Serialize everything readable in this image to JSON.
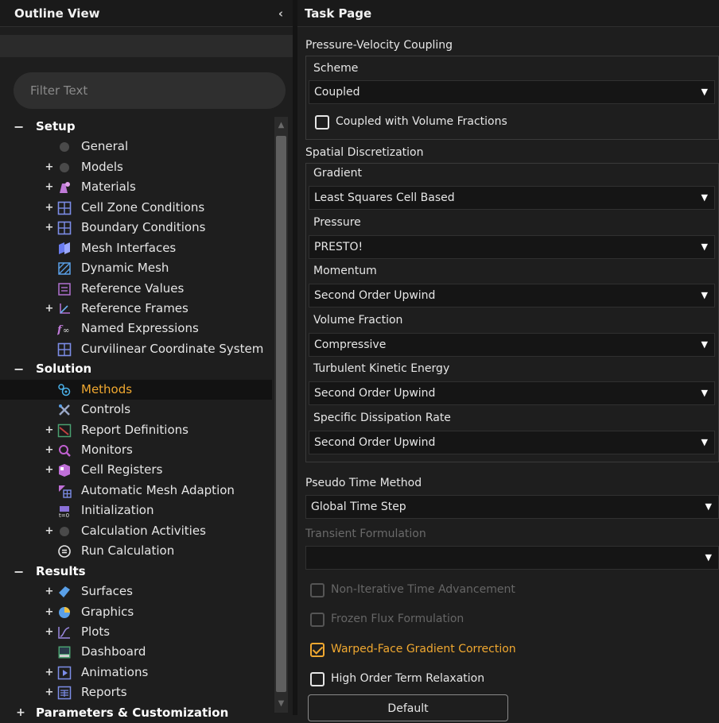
{
  "outline": {
    "title": "Outline View",
    "collapse_glyph": "‹",
    "filter_placeholder": "Filter Text",
    "items": [
      {
        "kind": "section",
        "exp": "−",
        "label": "Setup"
      },
      {
        "kind": "item",
        "exp": "",
        "label": "General",
        "icon": "general-icon",
        "color": "#4a4a4a"
      },
      {
        "kind": "item",
        "exp": "+",
        "label": "Models",
        "icon": "models-icon",
        "color": "#4a4a4a"
      },
      {
        "kind": "item",
        "exp": "+",
        "label": "Materials",
        "icon": "materials-icon",
        "color": "#c07ad8"
      },
      {
        "kind": "item",
        "exp": "+",
        "label": "Cell Zone Conditions",
        "icon": "cell-zone-icon",
        "color": "#7c8de8"
      },
      {
        "kind": "item",
        "exp": "+",
        "label": "Boundary Conditions",
        "icon": "boundary-icon",
        "color": "#7c8de8"
      },
      {
        "kind": "item",
        "exp": "",
        "label": "Mesh Interfaces",
        "icon": "mesh-interfaces-icon",
        "color": "#6a7cf0"
      },
      {
        "kind": "item",
        "exp": "",
        "label": "Dynamic Mesh",
        "icon": "dynamic-mesh-icon",
        "color": "#5aa0e8"
      },
      {
        "kind": "item",
        "exp": "",
        "label": "Reference Values",
        "icon": "reference-values-icon",
        "color": "#b070d0"
      },
      {
        "kind": "item",
        "exp": "+",
        "label": "Reference Frames",
        "icon": "reference-frames-icon",
        "color": "#b070d0"
      },
      {
        "kind": "item",
        "exp": "",
        "label": "Named Expressions",
        "icon": "named-expressions-icon",
        "color": "#c07ad8"
      },
      {
        "kind": "item",
        "exp": "",
        "label": "Curvilinear Coordinate System",
        "icon": "curvilinear-icon",
        "color": "#7c8de8"
      },
      {
        "kind": "section",
        "exp": "−",
        "label": "Solution"
      },
      {
        "kind": "item",
        "exp": "",
        "label": "Methods",
        "icon": "methods-icon",
        "color": "#4ab0e8",
        "selected": true
      },
      {
        "kind": "item",
        "exp": "",
        "label": "Controls",
        "icon": "controls-icon",
        "color": "#9aa8c8"
      },
      {
        "kind": "item",
        "exp": "+",
        "label": "Report Definitions",
        "icon": "report-definitions-icon",
        "color": "#c04040"
      },
      {
        "kind": "item",
        "exp": "+",
        "label": "Monitors",
        "icon": "monitors-icon",
        "color": "#c060d0"
      },
      {
        "kind": "item",
        "exp": "+",
        "label": "Cell Registers",
        "icon": "cell-registers-icon",
        "color": "#c070d8"
      },
      {
        "kind": "item",
        "exp": "",
        "label": "Automatic Mesh Adaption",
        "icon": "mesh-adaption-icon",
        "color": "#7c8de8"
      },
      {
        "kind": "item",
        "exp": "",
        "label": "Initialization",
        "icon": "initialization-icon",
        "color": "#8a70d8"
      },
      {
        "kind": "item",
        "exp": "+",
        "label": "Calculation Activities",
        "icon": "calculation-activities-icon",
        "color": "#4a4a4a"
      },
      {
        "kind": "item",
        "exp": "",
        "label": "Run Calculation",
        "icon": "run-calculation-icon",
        "color": "#e6e6e6"
      },
      {
        "kind": "section",
        "exp": "−",
        "label": "Results"
      },
      {
        "kind": "item",
        "exp": "+",
        "label": "Surfaces",
        "icon": "surfaces-icon",
        "color": "#5aa0e8"
      },
      {
        "kind": "item",
        "exp": "+",
        "label": "Graphics",
        "icon": "graphics-icon",
        "color": "#5aa0e8"
      },
      {
        "kind": "item",
        "exp": "+",
        "label": "Plots",
        "icon": "plots-icon",
        "color": "#9a88e0"
      },
      {
        "kind": "item",
        "exp": "",
        "label": "Dashboard",
        "icon": "dashboard-icon",
        "color": "#4aa070"
      },
      {
        "kind": "item",
        "exp": "+",
        "label": "Animations",
        "icon": "animations-icon",
        "color": "#7c8de8"
      },
      {
        "kind": "item",
        "exp": "+",
        "label": "Reports",
        "icon": "reports-icon",
        "color": "#7c8de8"
      },
      {
        "kind": "section",
        "exp": "+",
        "label": "Parameters & Customization",
        "param": true
      }
    ]
  },
  "task": {
    "title": "Task Page",
    "pv_coupling": {
      "title": "Pressure-Velocity Coupling",
      "scheme_label": "Scheme",
      "scheme_value": "Coupled",
      "coupled_vf_label": "Coupled with Volume Fractions",
      "coupled_vf_checked": false
    },
    "spatial": {
      "title": "Spatial Discretization",
      "fields": [
        {
          "label": "Gradient",
          "value": "Least Squares Cell Based"
        },
        {
          "label": "Pressure",
          "value": "PRESTO!"
        },
        {
          "label": "Momentum",
          "value": "Second Order Upwind"
        },
        {
          "label": "Volume Fraction",
          "value": "Compressive"
        },
        {
          "label": "Turbulent Kinetic Energy",
          "value": "Second Order Upwind"
        },
        {
          "label": "Specific Dissipation Rate",
          "value": "Second Order Upwind"
        }
      ]
    },
    "pseudo_time_label": "Pseudo Time Method",
    "pseudo_time_value": "Global Time Step",
    "transient_label": "Transient Formulation",
    "transient_value": "",
    "checkboxes": [
      {
        "label": "Non-Iterative Time Advancement",
        "state": "disabled"
      },
      {
        "label": "Frozen Flux Formulation",
        "state": "disabled"
      },
      {
        "label": "Warped-Face Gradient Correction",
        "state": "checked"
      },
      {
        "label": "High Order Term Relaxation",
        "state": "unchecked"
      }
    ],
    "default_button": "Default",
    "accent_color": "#f0a830"
  }
}
